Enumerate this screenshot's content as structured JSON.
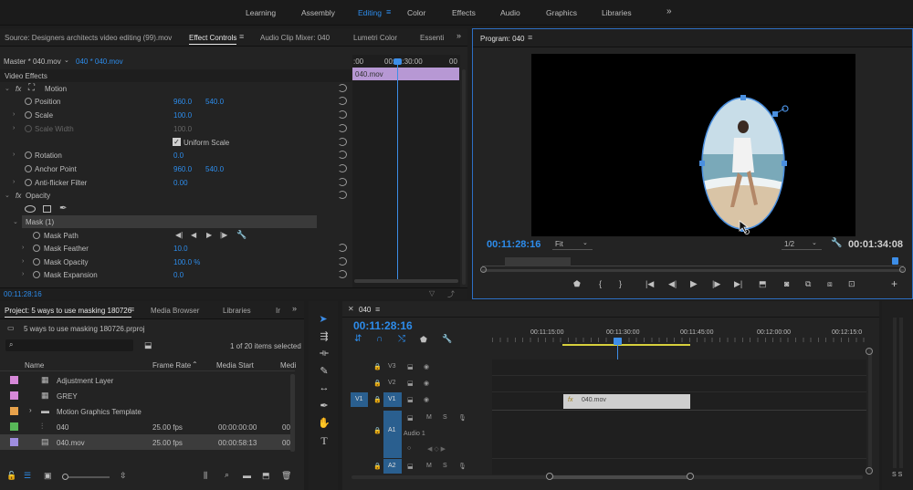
{
  "workspaces": {
    "items": [
      "Learning",
      "Assembly",
      "Editing",
      "Color",
      "Effects",
      "Audio",
      "Graphics",
      "Libraries"
    ],
    "more": "»"
  },
  "source_panel": {
    "tabs": [
      "Source: Designers architects video editing (99).mov",
      "Effect Controls",
      "Audio Clip Mixer: 040",
      "Lumetri Color",
      "Essenti"
    ],
    "master": "Master * 040.mov",
    "clip": "040 * 040.mov",
    "ruler": {
      "t0": ":00",
      "t1": "00:11:30:00",
      "t2": "00"
    },
    "clip_bar": "040.mov",
    "section": "Video Effects",
    "motion": "Motion",
    "position": {
      "label": "Position",
      "x": "960.0",
      "y": "540.0"
    },
    "scale": {
      "label": "Scale",
      "v": "100.0"
    },
    "scale_width": {
      "label": "Scale Width",
      "v": "100.0"
    },
    "uniform": "Uniform Scale",
    "rotation": {
      "label": "Rotation",
      "v": "0.0"
    },
    "anchor": {
      "label": "Anchor Point",
      "x": "960.0",
      "y": "540.0"
    },
    "flicker": {
      "label": "Anti-flicker Filter",
      "v": "0.00"
    },
    "opacity": "Opacity",
    "mask": "Mask (1)",
    "mask_path": "Mask Path",
    "mask_feather": {
      "label": "Mask Feather",
      "v": "10.0"
    },
    "mask_opacity": {
      "label": "Mask Opacity",
      "v": "100.0 %"
    },
    "mask_expansion": {
      "label": "Mask Expansion",
      "v": "0.0"
    },
    "timecode": "00:11:28:16"
  },
  "program": {
    "title": "Program: 040",
    "timecode": "00:11:28:16",
    "fit": "Fit",
    "res": "1/2",
    "duration": "00:01:34:08"
  },
  "project": {
    "tabs": [
      "Project: 5 ways to use masking 180726",
      "Media Browser",
      "Libraries",
      "Ir"
    ],
    "file": "5 ways to use masking 180726.prproj",
    "count": "1 of 20 items selected",
    "columns": [
      "Name",
      "Frame Rate",
      "Media Start",
      "Medi"
    ],
    "items": [
      {
        "name": "Adjustment Layer",
        "rate": "",
        "start": "",
        "end": "",
        "color": "#d688d8"
      },
      {
        "name": "GREY",
        "rate": "",
        "start": "",
        "end": "",
        "color": "#d688d8"
      },
      {
        "name": "Motion Graphics Template",
        "rate": "",
        "start": "",
        "end": "",
        "color": "#e8a24b"
      },
      {
        "name": "040",
        "rate": "25.00 fps",
        "start": "00:00:00:00",
        "end": "00",
        "color": "#58b858"
      },
      {
        "name": "040.mov",
        "rate": "25.00 fps",
        "start": "00:00:58:13",
        "end": "00",
        "color": "#9f8ee0"
      }
    ]
  },
  "timeline": {
    "title": "040",
    "timecode": "00:11:28:16",
    "ruler": [
      "00:11:15:00",
      "00:11:30:00",
      "00:11:45:00",
      "00:12:00:00",
      "00:12:15:0"
    ],
    "tracks": [
      "V3",
      "V2",
      "V1",
      "A1",
      "A2"
    ],
    "source_v": "V1",
    "audio_label": "Audio 1",
    "clip": "040.mov",
    "btn_m": "M",
    "btn_s": "S",
    "meter": "S S"
  }
}
